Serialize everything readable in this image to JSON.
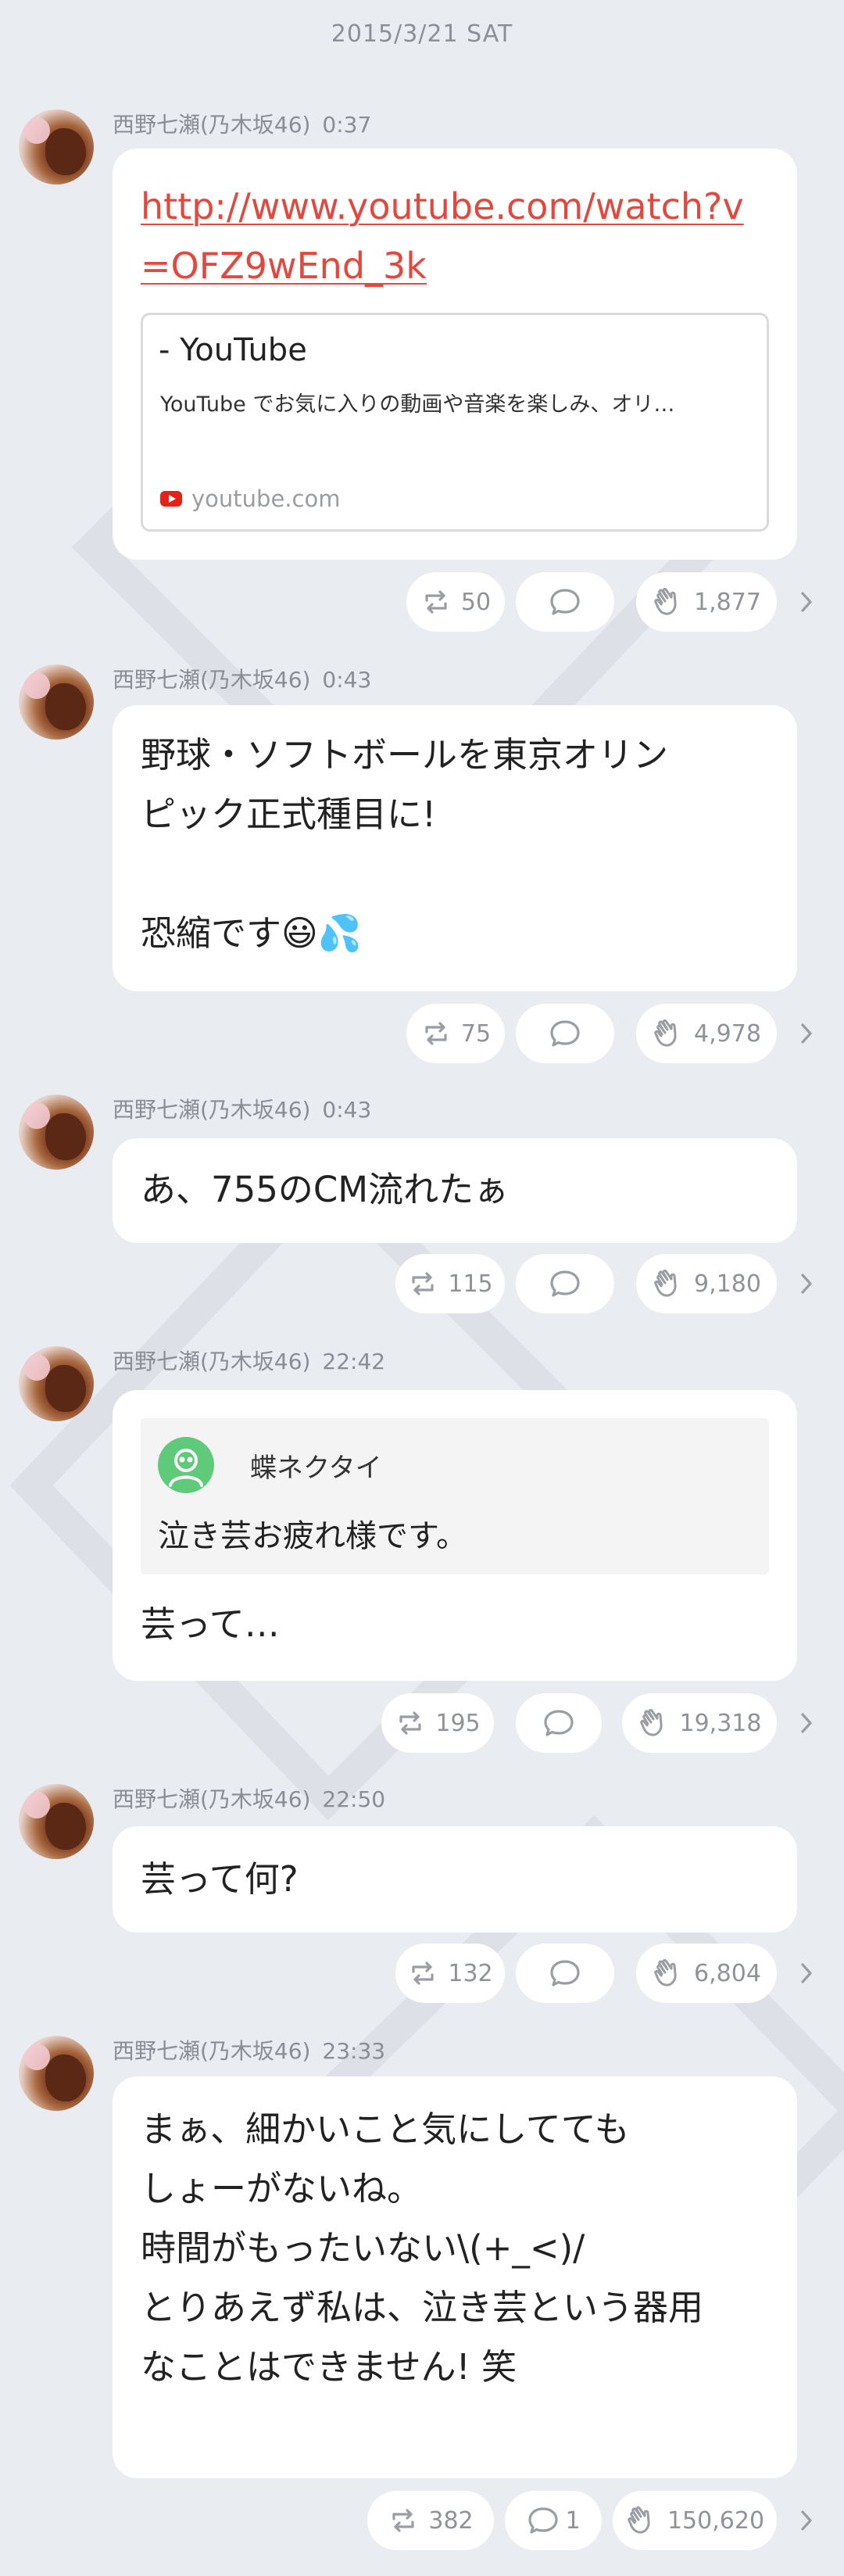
{
  "date_header": "2015/3/21 SAT",
  "posts": [
    {
      "author": "西野七瀬(乃木坂46)",
      "time": "0:37",
      "link": "http://www.youtube.com/watch?v=OFZ9wEnd_3k",
      "card": {
        "title": " - YouTube",
        "description": "YouTube でお気に入りの動画や音楽を楽しみ、オリ…",
        "domain": "youtube.com"
      },
      "actions": {
        "repost": "50",
        "comment": "",
        "clap": "1,877"
      }
    },
    {
      "author": "西野七瀬(乃木坂46)",
      "time": "0:43",
      "text": "野球・ソフトボールを東京オリン\nピック正式種目に!\n\n恐縮です😃💦",
      "actions": {
        "repost": "75",
        "comment": "",
        "clap": "4,978"
      }
    },
    {
      "author": "西野七瀬(乃木坂46)",
      "time": "0:43",
      "text": "あ、755のCM流れたぁ",
      "actions": {
        "repost": "115",
        "comment": "",
        "clap": "9,180"
      }
    },
    {
      "author": "西野七瀬(乃木坂46)",
      "time": "22:42",
      "quote": {
        "name": "蝶ネクタイ",
        "text": "泣き芸お疲れ様です。"
      },
      "text": "芸って…",
      "actions": {
        "repost": "195",
        "comment": "",
        "clap": "19,318"
      }
    },
    {
      "author": "西野七瀬(乃木坂46)",
      "time": "22:50",
      "text": "芸って何?",
      "actions": {
        "repost": "132",
        "comment": "",
        "clap": "6,804"
      }
    },
    {
      "author": "西野七瀬(乃木坂46)",
      "time": "23:33",
      "text": "まぁ、細かいこと気にしてても\nしょーがないね。\n時間がもったいない\\(+_<)/\nとりあえず私は、泣き芸という器用\nなことはできません! 笑",
      "actions": {
        "repost": "382",
        "comment": "1",
        "clap": "150,620"
      }
    }
  ],
  "icons": {
    "repost": "repost-icon",
    "comment": "comment-icon",
    "clap": "clap-icon",
    "more": "chevron-right-icon",
    "link_source": "youtube-icon"
  },
  "colors": {
    "background": "#e9ecf0",
    "link": "#e2483d",
    "meta": "#8a8e94",
    "quote_avatar": "#5fca79"
  }
}
